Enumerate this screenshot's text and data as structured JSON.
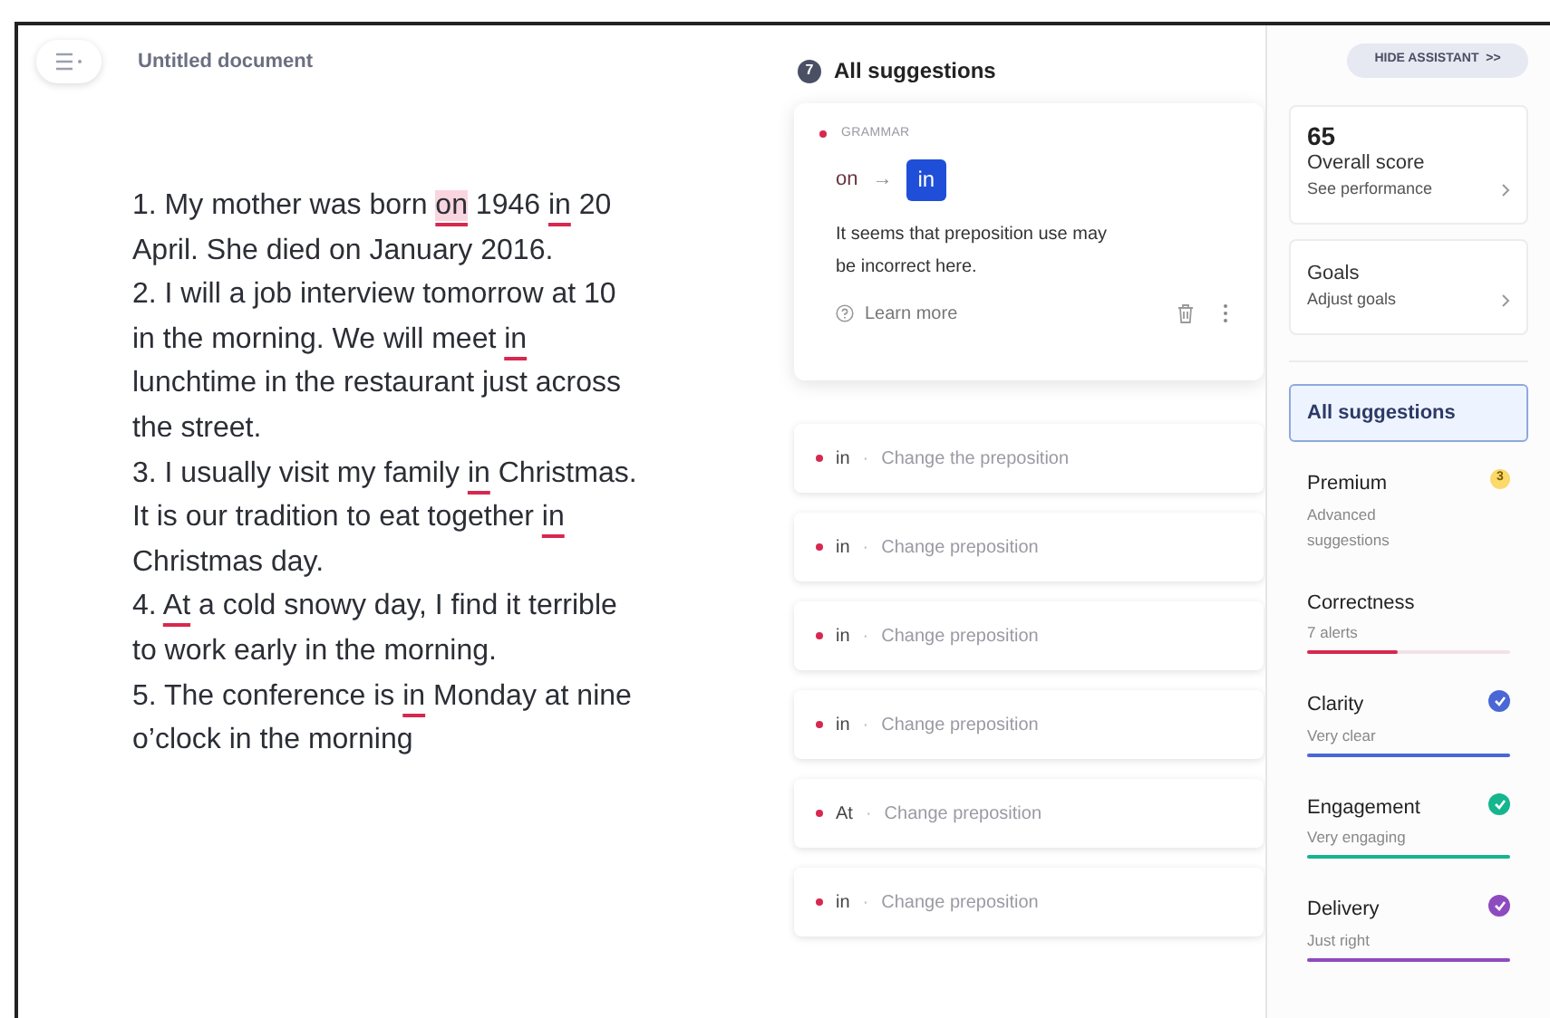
{
  "header": {
    "title": "Untitled document"
  },
  "document": {
    "lines": [
      [
        {
          "text": "1. My mother was born ",
          "kind": "plain"
        },
        {
          "text": "on",
          "kind": "active"
        },
        {
          "text": " 1946 ",
          "kind": "plain"
        },
        {
          "text": "in",
          "kind": "flagged"
        },
        {
          "text": " 20",
          "kind": "plain"
        }
      ],
      [
        {
          "text": "April. She died on January 2016.",
          "kind": "plain"
        }
      ],
      [
        {
          "text": "2. I will a job interview tomorrow at 10",
          "kind": "plain"
        }
      ],
      [
        {
          "text": "in the morning. We will meet ",
          "kind": "plain"
        },
        {
          "text": "in",
          "kind": "flagged"
        }
      ],
      [
        {
          "text": "lunchtime in the restaurant just across",
          "kind": "plain"
        }
      ],
      [
        {
          "text": "the street.",
          "kind": "plain"
        }
      ],
      [
        {
          "text": "3. I usually visit my family ",
          "kind": "plain"
        },
        {
          "text": "in",
          "kind": "flagged"
        },
        {
          "text": " Christmas.",
          "kind": "plain"
        }
      ],
      [
        {
          "text": "It is our tradition to eat together ",
          "kind": "plain"
        },
        {
          "text": "in",
          "kind": "flagged"
        }
      ],
      [
        {
          "text": "Christmas day.",
          "kind": "plain"
        }
      ],
      [
        {
          "text": "4. ",
          "kind": "plain"
        },
        {
          "text": "At",
          "kind": "flagged"
        },
        {
          "text": " a cold snowy day, I find it terrible",
          "kind": "plain"
        }
      ],
      [
        {
          "text": "to work early in the morning.",
          "kind": "plain"
        }
      ],
      [
        {
          "text": "5. The conference is ",
          "kind": "plain"
        },
        {
          "text": "in",
          "kind": "flagged"
        },
        {
          "text": " Monday at nine",
          "kind": "plain"
        }
      ],
      [
        {
          "text": "o’clock in the morning",
          "kind": "plain"
        }
      ]
    ]
  },
  "suggestions": {
    "count": "7",
    "title": "All suggestions",
    "active_card": {
      "category": "GRAMMAR",
      "from": "on",
      "arrow": "→",
      "to": "in",
      "message": "It seems that preposition use may be incorrect here.",
      "learn_more": "Learn more"
    },
    "items": [
      {
        "word": "in",
        "separator": "·",
        "description": "Change the preposition"
      },
      {
        "word": "in",
        "separator": "·",
        "description": "Change preposition"
      },
      {
        "word": "in",
        "separator": "·",
        "description": "Change preposition"
      },
      {
        "word": "in",
        "separator": "·",
        "description": "Change preposition"
      },
      {
        "word": "At",
        "separator": "·",
        "description": "Change preposition"
      },
      {
        "word": "in",
        "separator": "·",
        "description": "Change preposition"
      }
    ]
  },
  "assistant": {
    "hide_button": "HIDE ASSISTANT  >>",
    "score": {
      "value": "65",
      "label": "Overall score",
      "link": "See performance"
    },
    "goals": {
      "label": "Goals",
      "link": "Adjust goals"
    },
    "categories": [
      {
        "kind": "nav",
        "title": "All suggestions",
        "selected": true
      },
      {
        "kind": "premium",
        "title": "Premium",
        "subtitle": "Advanced suggestions",
        "badge": "3",
        "selected": false
      },
      {
        "kind": "metric",
        "title": "Correctness",
        "subtitle": "7 alerts",
        "color": "#d7284f",
        "level": 0.45,
        "checked": false,
        "selected": false
      },
      {
        "kind": "metric",
        "title": "Clarity",
        "subtitle": "Very clear",
        "color": "#4a67d6",
        "level": 1,
        "checked": true,
        "selected": false
      },
      {
        "kind": "metric",
        "title": "Engagement",
        "subtitle": "Very engaging",
        "color": "#15b58d",
        "level": 1,
        "checked": true,
        "selected": false
      },
      {
        "kind": "metric",
        "title": "Delivery",
        "subtitle": "Just right",
        "color": "#8e4bc0",
        "level": 1,
        "checked": true,
        "selected": false
      }
    ]
  }
}
